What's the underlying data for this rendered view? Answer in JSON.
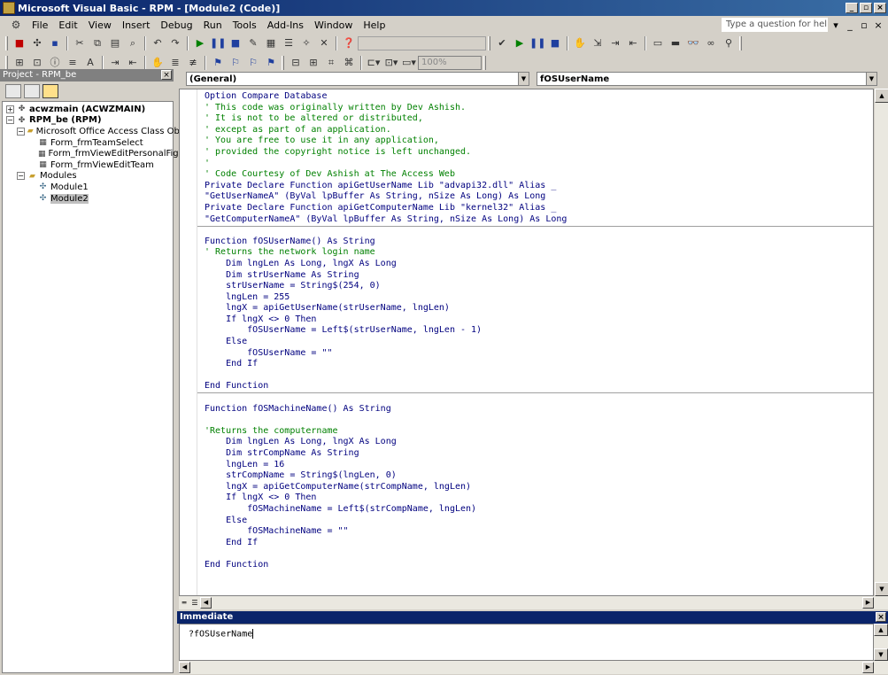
{
  "window": {
    "title": "Microsoft Visual Basic - RPM - [Module2 (Code)]",
    "icon": "vba-app-icon",
    "buttons": [
      "minimize",
      "restore",
      "close"
    ]
  },
  "menu": {
    "items": [
      "File",
      "Edit",
      "View",
      "Insert",
      "Debug",
      "Run",
      "Tools",
      "Add-Ins",
      "Window",
      "Help"
    ],
    "help_placeholder": "Type a question for help"
  },
  "toolbar": {
    "zoom": "100%"
  },
  "project": {
    "title": "Project - RPM_be",
    "tree": [
      {
        "label": "acwzmain (ACWZMAIN)",
        "level": 0,
        "expander": "+",
        "icon": "project-icon",
        "bold": true
      },
      {
        "label": "RPM_be (RPM)",
        "level": 0,
        "expander": "−",
        "icon": "project-icon",
        "bold": true
      },
      {
        "label": "Microsoft Office Access Class Objects",
        "level": 1,
        "expander": "−",
        "icon": "folder-icon",
        "bold": false
      },
      {
        "label": "Form_frmTeamSelect",
        "level": 2,
        "expander": "",
        "icon": "form-icon",
        "bold": false
      },
      {
        "label": "Form_frmViewEditPersonalFigures",
        "level": 2,
        "expander": "",
        "icon": "form-icon",
        "bold": false
      },
      {
        "label": "Form_frmViewEditTeam",
        "level": 2,
        "expander": "",
        "icon": "form-icon",
        "bold": false
      },
      {
        "label": "Modules",
        "level": 1,
        "expander": "−",
        "icon": "folder-icon",
        "bold": false
      },
      {
        "label": "Module1",
        "level": 2,
        "expander": "",
        "icon": "module-icon",
        "bold": false
      },
      {
        "label": "Module2",
        "level": 2,
        "expander": "",
        "icon": "module-icon",
        "bold": false,
        "selected": true
      }
    ]
  },
  "code": {
    "object_combo": "(General)",
    "procedure_combo": "fOSUserName",
    "lines": [
      {
        "text": "Option Compare Database",
        "kind": "keyword"
      },
      {
        "text": "' This code was originally written by Dev Ashish.",
        "kind": "comment"
      },
      {
        "text": "' It is not to be altered or distributed,",
        "kind": "comment"
      },
      {
        "text": "' except as part of an application.",
        "kind": "comment"
      },
      {
        "text": "' You are free to use it in any application,",
        "kind": "comment"
      },
      {
        "text": "' provided the copyright notice is left unchanged.",
        "kind": "comment"
      },
      {
        "text": "'",
        "kind": "comment"
      },
      {
        "text": "' Code Courtesy of Dev Ashish at The Access Web",
        "kind": "comment"
      },
      {
        "text": "Private Declare Function apiGetUserName Lib \"advapi32.dll\" Alias _",
        "kind": "keyword"
      },
      {
        "text": "\"GetUserNameA\" (ByVal lpBuffer As String, nSize As Long) As Long",
        "kind": "keyword"
      },
      {
        "text": "Private Declare Function apiGetComputerName Lib \"kernel32\" Alias _",
        "kind": "keyword"
      },
      {
        "text": "\"GetComputerNameA\" (ByVal lpBuffer As String, nSize As Long) As Long",
        "kind": "keyword"
      },
      {
        "text": "",
        "kind": "plain"
      },
      {
        "text": "Function fOSUserName() As String",
        "kind": "keyword"
      },
      {
        "text": "' Returns the network login name",
        "kind": "comment"
      },
      {
        "text": "    Dim lngLen As Long, lngX As Long",
        "kind": "keyword"
      },
      {
        "text": "    Dim strUserName As String",
        "kind": "keyword"
      },
      {
        "text": "    strUserName = String$(254, 0)",
        "kind": "keyword"
      },
      {
        "text": "    lngLen = 255",
        "kind": "keyword"
      },
      {
        "text": "    lngX = apiGetUserName(strUserName, lngLen)",
        "kind": "keyword"
      },
      {
        "text": "    If lngX <> 0 Then",
        "kind": "keyword"
      },
      {
        "text": "        fOSUserName = Left$(strUserName, lngLen - 1)",
        "kind": "keyword"
      },
      {
        "text": "    Else",
        "kind": "keyword"
      },
      {
        "text": "        fOSUserName = \"\"",
        "kind": "keyword"
      },
      {
        "text": "    End If",
        "kind": "keyword"
      },
      {
        "text": "",
        "kind": "plain"
      },
      {
        "text": "End Function",
        "kind": "keyword"
      },
      {
        "text": "",
        "kind": "plain"
      },
      {
        "text": "Function fOSMachineName() As String",
        "kind": "keyword"
      },
      {
        "text": "",
        "kind": "plain"
      },
      {
        "text": "'Returns the computername",
        "kind": "comment"
      },
      {
        "text": "    Dim lngLen As Long, lngX As Long",
        "kind": "keyword"
      },
      {
        "text": "    Dim strCompName As String",
        "kind": "keyword"
      },
      {
        "text": "    lngLen = 16",
        "kind": "keyword"
      },
      {
        "text": "    strCompName = String$(lngLen, 0)",
        "kind": "keyword"
      },
      {
        "text": "    lngX = apiGetComputerName(strCompName, lngLen)",
        "kind": "keyword"
      },
      {
        "text": "    If lngX <> 0 Then",
        "kind": "keyword"
      },
      {
        "text": "        fOSMachineName = Left$(strCompName, lngLen)",
        "kind": "keyword"
      },
      {
        "text": "    Else",
        "kind": "keyword"
      },
      {
        "text": "        fOSMachineName = \"\"",
        "kind": "keyword"
      },
      {
        "text": "    End If",
        "kind": "keyword"
      },
      {
        "text": "",
        "kind": "plain"
      },
      {
        "text": "End Function",
        "kind": "keyword"
      }
    ]
  },
  "immediate": {
    "title": "Immediate",
    "text": "?fOSUserName"
  }
}
